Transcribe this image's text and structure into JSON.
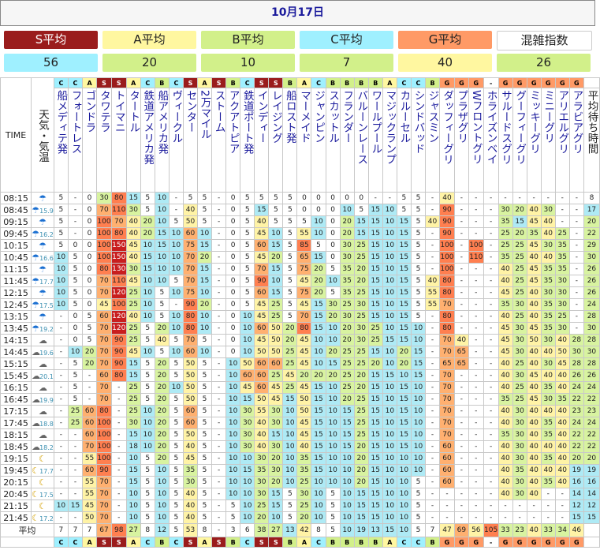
{
  "title": "10月17日",
  "averages": [
    {
      "label": "S平均",
      "value": "56",
      "label_bg": "#9a1c1c",
      "label_color": "#ffffff",
      "value_bg": "#9ff0ff"
    },
    {
      "label": "A平均",
      "value": "20",
      "label_bg": "#fff7a0",
      "label_color": "#222222",
      "value_bg": "#d2f08a"
    },
    {
      "label": "B平均",
      "value": "10",
      "label_bg": "#d2f08a",
      "label_color": "#222222",
      "value_bg": "#d2f08a"
    },
    {
      "label": "C平均",
      "value": "7",
      "label_bg": "#9ff0ff",
      "label_color": "#222222",
      "value_bg": "#d2f08a"
    },
    {
      "label": "G平均",
      "value": "40",
      "label_bg": "#ff9a66",
      "label_color": "#222222",
      "value_bg": "#fff7a0"
    },
    {
      "label": "混雑指数",
      "value": "26",
      "label_bg": "#ffffff",
      "label_color": "#222222",
      "value_bg": "#d2f08a"
    }
  ],
  "header": {
    "time": "TIME",
    "weather": "天気・気温",
    "avg_wait": "平均待ち時間"
  },
  "categories": [
    "C",
    "C",
    "A",
    "S",
    "S",
    "A",
    "C",
    "B",
    "C",
    "S",
    "A",
    "S",
    "B",
    "C",
    "S",
    "S",
    "B",
    "A",
    "C",
    "B",
    "B",
    "B",
    "B",
    "A",
    "C",
    "C",
    "B",
    "G",
    "G",
    "G",
    "-",
    "G",
    "G",
    "G",
    "G",
    "G",
    "G"
  ],
  "attractions": [
    "船メディテ発",
    "フォートレス",
    "ゴンドラ",
    "タワテラ",
    "トイマニ",
    "タートル",
    "鉄道アメリカ発",
    "船アメリカ発",
    "ヴィークル",
    "センター",
    "2万マイル",
    "ストーム",
    "アクアトピア",
    "鉄道ポート発",
    "インディー",
    "レイジング",
    "船ロスト発",
    "マーメイド",
    "ジャンピン",
    "スカットル",
    "フランダー",
    "バルーンレース",
    "ワールプール",
    "マジックランプ",
    "カルーセル",
    "シンドバッド",
    "ジャスミン",
    "ダッフィーグリ",
    "プラザグリ",
    "Wフロントグリ",
    "ホライズンベイ",
    "サルードスグリ",
    "グーフィーグリ",
    "ミッキーグリ",
    "ミニーグリ",
    "アリエルグリ",
    "アラビアグリ"
  ],
  "rows": [
    {
      "time": "08:15",
      "w": "u",
      "temp": "",
      "vals": [
        "5",
        "-",
        "0",
        "30",
        "80",
        "15",
        "5",
        "10",
        "-",
        "5",
        "5",
        "-",
        "0",
        "5",
        "5",
        "5",
        "5",
        "0",
        "0",
        "0",
        "0",
        "0",
        "-",
        "-",
        "5",
        "5",
        "-",
        "40",
        "-",
        "-",
        "-",
        "-",
        "-",
        "-",
        "-",
        "-",
        "-"
      ],
      "avg": "8"
    },
    {
      "time": "08:45",
      "w": "u",
      "temp": "15.9",
      "vals": [
        "5",
        "-",
        "0",
        "70",
        "110",
        "30",
        "5",
        "10",
        "-",
        "40",
        "5",
        "-",
        "0",
        "5",
        "15",
        "5",
        "5",
        "0",
        "0",
        "0",
        "10",
        "5",
        "15",
        "10",
        "5",
        "5",
        "-",
        "90",
        "-",
        "-",
        "-",
        "30",
        "20",
        "40",
        "30",
        "-",
        "-"
      ],
      "avg": "17"
    },
    {
      "time": "09:15",
      "w": "u",
      "temp": "",
      "vals": [
        "5",
        "-",
        "0",
        "100",
        "70",
        "40",
        "20",
        "10",
        "5",
        "50",
        "5",
        "-",
        "0",
        "5",
        "40",
        "5",
        "5",
        "5",
        "10",
        "0",
        "20",
        "15",
        "15",
        "10",
        "15",
        "5",
        "40",
        "90",
        "-",
        "-",
        "-",
        "35",
        "15",
        "45",
        "40",
        "-",
        "-"
      ],
      "avg": "20"
    },
    {
      "time": "09:45",
      "w": "u",
      "temp": "16.2",
      "vals": [
        "5",
        "-",
        "0",
        "100",
        "80",
        "40",
        "20",
        "15",
        "10",
        "60",
        "10",
        "-",
        "0",
        "5",
        "45",
        "10",
        "5",
        "55",
        "10",
        "0",
        "20",
        "15",
        "15",
        "10",
        "15",
        "5",
        "-",
        "90",
        "-",
        "-",
        "-",
        "25",
        "20",
        "35",
        "40",
        "25",
        "-"
      ],
      "avg": "22"
    },
    {
      "time": "10:15",
      "w": "u",
      "temp": "",
      "vals": [
        "5",
        "0",
        "0",
        "100",
        "150",
        "45",
        "10",
        "15",
        "10",
        "75",
        "15",
        "-",
        "0",
        "5",
        "60",
        "15",
        "5",
        "85",
        "5",
        "0",
        "30",
        "25",
        "15",
        "10",
        "15",
        "5",
        "-",
        "100",
        "-",
        "100",
        "-",
        "25",
        "25",
        "45",
        "30",
        "35",
        "-"
      ],
      "avg": "29"
    },
    {
      "time": "10:45",
      "w": "u",
      "temp": "16.6",
      "vals": [
        "10",
        "5",
        "0",
        "100",
        "150",
        "40",
        "15",
        "10",
        "10",
        "70",
        "20",
        "-",
        "0",
        "5",
        "45",
        "20",
        "5",
        "65",
        "15",
        "0",
        "30",
        "25",
        "15",
        "10",
        "15",
        "5",
        "-",
        "100",
        "-",
        "110",
        "-",
        "35",
        "25",
        "40",
        "40",
        "35",
        "-"
      ],
      "avg": "30"
    },
    {
      "time": "11:15",
      "w": "u",
      "temp": "",
      "vals": [
        "10",
        "5",
        "0",
        "80",
        "130",
        "30",
        "15",
        "10",
        "10",
        "70",
        "15",
        "-",
        "0",
        "5",
        "70",
        "15",
        "5",
        "75",
        "20",
        "5",
        "35",
        "20",
        "15",
        "10",
        "15",
        "5",
        "-",
        "100",
        "-",
        "-",
        "-",
        "40",
        "25",
        "45",
        "35",
        "35",
        "-"
      ],
      "avg": "26"
    },
    {
      "time": "11:45",
      "w": "u",
      "temp": "17.7",
      "vals": [
        "10",
        "5",
        "0",
        "70",
        "110",
        "45",
        "10",
        "10",
        "5",
        "70",
        "15",
        "-",
        "0",
        "5",
        "90",
        "10",
        "5",
        "45",
        "20",
        "10",
        "35",
        "20",
        "15",
        "10",
        "15",
        "5",
        "40",
        "80",
        "-",
        "-",
        "-",
        "40",
        "25",
        "45",
        "35",
        "30",
        "-"
      ],
      "avg": "26"
    },
    {
      "time": "12:15",
      "w": "u",
      "temp": "",
      "vals": [
        "10",
        "5",
        "0",
        "70",
        "120",
        "25",
        "10",
        "5",
        "10",
        "75",
        "10",
        "-",
        "0",
        "5",
        "60",
        "15",
        "5",
        "75",
        "20",
        "5",
        "35",
        "25",
        "15",
        "10",
        "15",
        "5",
        "55",
        "80",
        "-",
        "-",
        "-",
        "45",
        "25",
        "40",
        "30",
        "30",
        "-"
      ],
      "avg": "26"
    },
    {
      "time": "12:45",
      "w": "u",
      "temp": "17.5",
      "vals": [
        "10",
        "5",
        "0",
        "45",
        "100",
        "25",
        "10",
        "5",
        "-",
        "90",
        "20",
        "-",
        "0",
        "5",
        "45",
        "25",
        "5",
        "45",
        "15",
        "30",
        "25",
        "30",
        "15",
        "10",
        "15",
        "5",
        "55",
        "70",
        "-",
        "-",
        "-",
        "35",
        "30",
        "40",
        "35",
        "30",
        "-"
      ],
      "avg": "24"
    },
    {
      "time": "13:15",
      "w": "u",
      "temp": "",
      "vals": [
        "-",
        "0",
        "5",
        "60",
        "120",
        "40",
        "10",
        "5",
        "10",
        "80",
        "10",
        "-",
        "0",
        "10",
        "45",
        "25",
        "5",
        "70",
        "15",
        "20",
        "30",
        "25",
        "15",
        "10",
        "15",
        "5",
        "-",
        "80",
        "-",
        "-",
        "-",
        "40",
        "25",
        "40",
        "35",
        "25",
        "-"
      ],
      "avg": "28"
    },
    {
      "time": "13:45",
      "w": "u",
      "temp": "19.2",
      "vals": [
        "-",
        "0",
        "5",
        "70",
        "120",
        "25",
        "5",
        "20",
        "10",
        "80",
        "10",
        "-",
        "0",
        "10",
        "60",
        "50",
        "20",
        "80",
        "15",
        "10",
        "20",
        "30",
        "25",
        "10",
        "15",
        "10",
        "-",
        "80",
        "-",
        "-",
        "-",
        "45",
        "30",
        "45",
        "35",
        "30",
        "-"
      ],
      "avg": "30"
    },
    {
      "time": "14:15",
      "w": "c",
      "temp": "",
      "vals": [
        "-",
        "0",
        "5",
        "70",
        "90",
        "25",
        "5",
        "40",
        "5",
        "70",
        "5",
        "-",
        "0",
        "10",
        "45",
        "50",
        "20",
        "45",
        "10",
        "10",
        "20",
        "30",
        "25",
        "15",
        "15",
        "10",
        "-",
        "70",
        "40",
        "-",
        "-",
        "45",
        "30",
        "50",
        "30",
        "40",
        "28"
      ],
      "avg": "28"
    },
    {
      "time": "14:45",
      "w": "c",
      "temp": "19.6",
      "vals": [
        "-",
        "10",
        "20",
        "70",
        "90",
        "45",
        "10",
        "5",
        "10",
        "60",
        "10",
        "-",
        "0",
        "10",
        "50",
        "50",
        "25",
        "45",
        "10",
        "20",
        "25",
        "25",
        "15",
        "10",
        "20",
        "15",
        "-",
        "70",
        "65",
        "-",
        "-",
        "45",
        "30",
        "40",
        "40",
        "50",
        "30"
      ],
      "avg": "30"
    },
    {
      "time": "15:15",
      "w": "c",
      "temp": "",
      "vals": [
        "-",
        "5",
        "20",
        "70",
        "90",
        "15",
        "5",
        "20",
        "5",
        "50",
        "5",
        "-",
        "10",
        "50",
        "60",
        "60",
        "25",
        "45",
        "10",
        "15",
        "25",
        "25",
        "20",
        "10",
        "20",
        "15",
        "-",
        "65",
        "65",
        "-",
        "-",
        "40",
        "25",
        "40",
        "30",
        "45",
        "28"
      ],
      "avg": "28"
    },
    {
      "time": "15:45",
      "w": "c",
      "temp": "20.1",
      "vals": [
        "-",
        "5",
        "-",
        "60",
        "80",
        "15",
        "5",
        "20",
        "5",
        "50",
        "5",
        "-",
        "10",
        "60",
        "60",
        "25",
        "45",
        "20",
        "20",
        "20",
        "25",
        "20",
        "15",
        "15",
        "10",
        "15",
        "-",
        "70",
        "-",
        "-",
        "-",
        "40",
        "30",
        "45",
        "40",
        "40",
        "26"
      ],
      "avg": "26"
    },
    {
      "time": "16:15",
      "w": "c",
      "temp": "",
      "vals": [
        "-",
        "5",
        "-",
        "70",
        "-",
        "25",
        "5",
        "20",
        "10",
        "50",
        "5",
        "-",
        "10",
        "45",
        "60",
        "45",
        "25",
        "45",
        "15",
        "10",
        "25",
        "20",
        "15",
        "10",
        "15",
        "10",
        "-",
        "70",
        "-",
        "-",
        "-",
        "40",
        "25",
        "40",
        "35",
        "40",
        "24"
      ],
      "avg": "24"
    },
    {
      "time": "16:45",
      "w": "c",
      "temp": "19.9",
      "vals": [
        "-",
        "5",
        "-",
        "70",
        "-",
        "25",
        "5",
        "20",
        "5",
        "50",
        "5",
        "-",
        "10",
        "15",
        "50",
        "45",
        "15",
        "50",
        "15",
        "10",
        "20",
        "25",
        "15",
        "10",
        "15",
        "10",
        "-",
        "70",
        "-",
        "-",
        "-",
        "35",
        "25",
        "45",
        "30",
        "35",
        "22"
      ],
      "avg": "22"
    },
    {
      "time": "17:15",
      "w": "c",
      "temp": "",
      "vals": [
        "-",
        "25",
        "60",
        "80",
        "-",
        "25",
        "10",
        "20",
        "5",
        "60",
        "5",
        "-",
        "10",
        "30",
        "55",
        "30",
        "10",
        "50",
        "15",
        "10",
        "15",
        "25",
        "15",
        "10",
        "15",
        "10",
        "-",
        "70",
        "-",
        "-",
        "-",
        "40",
        "30",
        "40",
        "40",
        "40",
        "23"
      ],
      "avg": "23"
    },
    {
      "time": "17:45",
      "w": "c",
      "temp": "18.8",
      "vals": [
        "-",
        "25",
        "60",
        "100",
        "-",
        "30",
        "10",
        "20",
        "5",
        "60",
        "5",
        "-",
        "10",
        "30",
        "40",
        "30",
        "10",
        "45",
        "15",
        "10",
        "15",
        "25",
        "15",
        "10",
        "15",
        "10",
        "-",
        "70",
        "-",
        "-",
        "-",
        "40",
        "30",
        "40",
        "35",
        "40",
        "24"
      ],
      "avg": "24"
    },
    {
      "time": "18:15",
      "w": "c",
      "temp": "",
      "vals": [
        "-",
        "-",
        "60",
        "100",
        "-",
        "15",
        "10",
        "20",
        "5",
        "50",
        "5",
        "-",
        "10",
        "30",
        "40",
        "15",
        "10",
        "45",
        "15",
        "10",
        "15",
        "25",
        "15",
        "10",
        "15",
        "10",
        "-",
        "70",
        "-",
        "-",
        "-",
        "35",
        "30",
        "40",
        "35",
        "40",
        "22"
      ],
      "avg": "22"
    },
    {
      "time": "18:45",
      "w": "c",
      "temp": "18.2",
      "vals": [
        "-",
        "-",
        "70",
        "100",
        "-",
        "18",
        "10",
        "20",
        "5",
        "40",
        "5",
        "-",
        "10",
        "30",
        "40",
        "30",
        "10",
        "40",
        "15",
        "10",
        "15",
        "20",
        "15",
        "10",
        "15",
        "10",
        "-",
        "60",
        "-",
        "-",
        "-",
        "40",
        "30",
        "40",
        "40",
        "40",
        "22"
      ],
      "avg": "22"
    },
    {
      "time": "19:15",
      "w": "m",
      "temp": "",
      "vals": [
        "-",
        "-",
        "55",
        "100",
        "-",
        "10",
        "5",
        "20",
        "5",
        "45",
        "5",
        "-",
        "10",
        "10",
        "30",
        "20",
        "10",
        "35",
        "15",
        "10",
        "10",
        "20",
        "15",
        "10",
        "10",
        "10",
        "-",
        "60",
        "-",
        "-",
        "-",
        "40",
        "30",
        "40",
        "35",
        "40",
        "20"
      ],
      "avg": "20"
    },
    {
      "time": "19:45",
      "w": "m",
      "temp": "17.7",
      "vals": [
        "-",
        "-",
        "60",
        "90",
        "-",
        "15",
        "5",
        "10",
        "5",
        "35",
        "5",
        "-",
        "10",
        "15",
        "35",
        "30",
        "10",
        "35",
        "15",
        "10",
        "10",
        "20",
        "15",
        "10",
        "10",
        "10",
        "-",
        "60",
        "-",
        "-",
        "-",
        "40",
        "35",
        "40",
        "40",
        "40",
        "19"
      ],
      "avg": "19"
    },
    {
      "time": "20:15",
      "w": "m",
      "temp": "",
      "vals": [
        "-",
        "-",
        "55",
        "70",
        "-",
        "15",
        "5",
        "10",
        "5",
        "30",
        "5",
        "-",
        "10",
        "10",
        "30",
        "20",
        "10",
        "25",
        "10",
        "10",
        "10",
        "20",
        "15",
        "10",
        "10",
        "5",
        "-",
        "60",
        "-",
        "-",
        "-",
        "40",
        "30",
        "40",
        "35",
        "40",
        "16"
      ],
      "avg": "16"
    },
    {
      "time": "20:45",
      "w": "m",
      "temp": "17.5",
      "vals": [
        "-",
        "-",
        "55",
        "70",
        "-",
        "10",
        "5",
        "10",
        "5",
        "40",
        "5",
        "-",
        "10",
        "10",
        "30",
        "15",
        "5",
        "30",
        "10",
        "5",
        "10",
        "15",
        "15",
        "10",
        "10",
        "5",
        "-",
        "-",
        "-",
        "-",
        "-",
        "40",
        "30",
        "40",
        "-",
        "-",
        "14"
      ],
      "avg": "14"
    },
    {
      "time": "21:15",
      "w": "m",
      "temp": "",
      "vals": [
        "10",
        "15",
        "45",
        "70",
        "-",
        "10",
        "5",
        "10",
        "5",
        "40",
        "5",
        "-",
        "5",
        "10",
        "25",
        "15",
        "5",
        "25",
        "10",
        "5",
        "10",
        "15",
        "15",
        "10",
        "10",
        "5",
        "-",
        "-",
        "-",
        "-",
        "-",
        "-",
        "-",
        "-",
        "-",
        "-",
        "12"
      ],
      "avg": "12"
    },
    {
      "time": "21:45",
      "w": "m",
      "temp": "17.2",
      "vals": [
        "-",
        "-",
        "50",
        "70",
        "-",
        "10",
        "5",
        "10",
        "5",
        "40",
        "5",
        "-",
        "5",
        "10",
        "20",
        "10",
        "5",
        "20",
        "10",
        "5",
        "10",
        "15",
        "15",
        "10",
        "10",
        "5",
        "-",
        "-",
        "-",
        "-",
        "-",
        "-",
        "-",
        "-",
        "-",
        "-",
        "15"
      ],
      "avg": "15"
    }
  ],
  "footer": {
    "label": "平均",
    "vals": [
      "7",
      "7",
      "7",
      "67",
      "98",
      "27",
      "8",
      "12",
      "5",
      "53",
      "8",
      "-",
      "3",
      "6",
      "38",
      "27",
      "13",
      "42",
      "8",
      "5",
      "10",
      "19",
      "13",
      "15",
      "10",
      "5",
      "7",
      "47",
      "69",
      "56",
      "105",
      "33",
      "23",
      "40",
      "33",
      "34",
      "46"
    ]
  },
  "colors": {
    "S": "#9a1c1c",
    "A": "#fff7a0",
    "B": "#d2f08a",
    "C": "#9ff0ff",
    "G": "#ff9a66"
  },
  "icons": {
    "u": "umbrella-icon",
    "c": "cloud-icon",
    "m": "moon-icon"
  }
}
